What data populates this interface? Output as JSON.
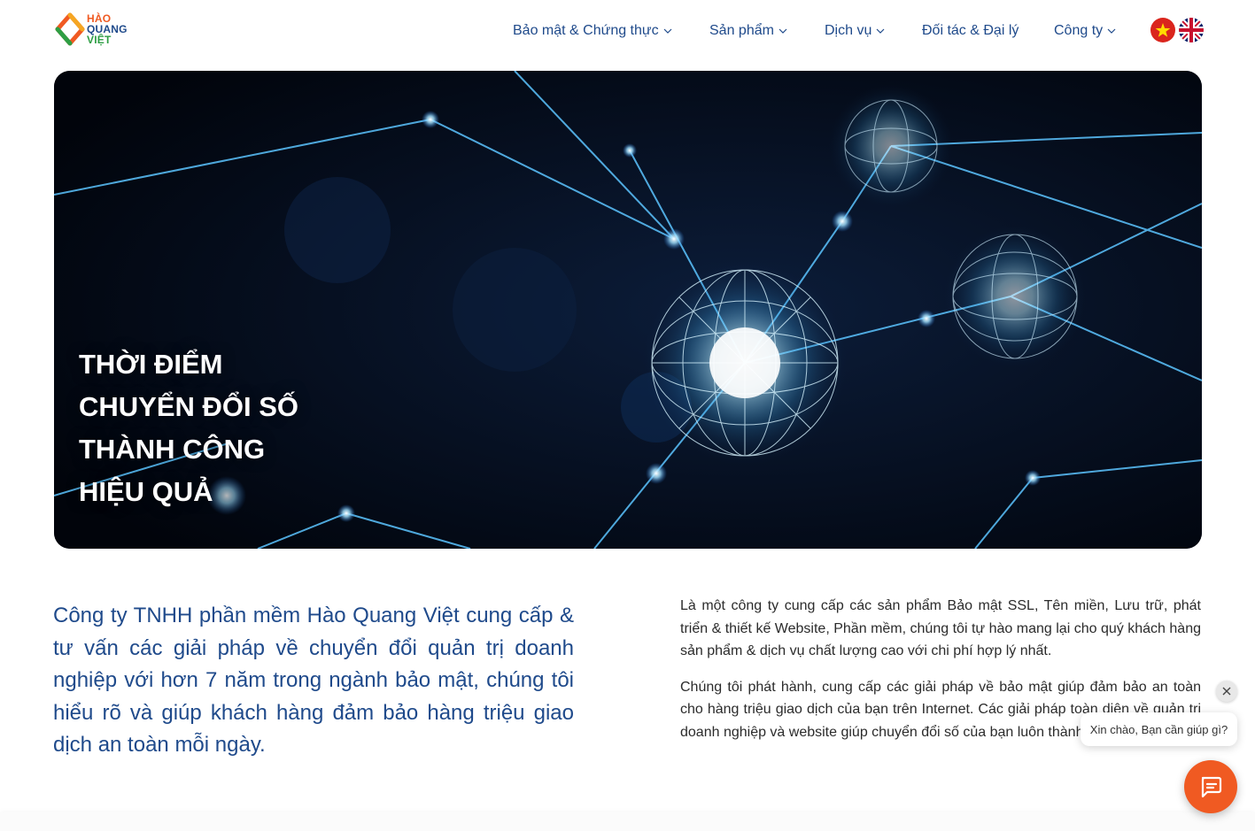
{
  "brand": {
    "logo_text_1": "HÀO",
    "logo_text_2": "QUANG",
    "logo_text_3": "VIỆT",
    "colors": {
      "primary": "#1f4a8b",
      "accent": "#f05a22",
      "green": "#2e9e44"
    }
  },
  "nav": {
    "items": [
      {
        "label": "Bảo mật & Chứng thực",
        "has_dropdown": true
      },
      {
        "label": "Sản phẩm",
        "has_dropdown": true
      },
      {
        "label": "Dịch vụ",
        "has_dropdown": true
      },
      {
        "label": "Đối tác & Đại lý",
        "has_dropdown": false
      },
      {
        "label": "Công ty",
        "has_dropdown": true
      }
    ],
    "languages": [
      {
        "icon": "vietnam-flag-icon",
        "code": "vi"
      },
      {
        "icon": "uk-flag-icon",
        "code": "en"
      }
    ]
  },
  "hero": {
    "title_lines": [
      "THỜI ĐIỂM",
      "CHUYỂN ĐỔI SỐ",
      "THÀNH CÔNG",
      "HIỆU QUẢ"
    ]
  },
  "intro": {
    "left_text": "Công ty TNHH phần mềm Hào Quang Việt cung cấp & tư vấn các giải pháp về chuyển đổi quản trị doanh nghiệp với hơn 7 năm trong ngành bảo mật, chúng tôi hiểu rõ và giúp khách hàng đảm bảo hàng triệu giao dịch an toàn mỗi ngày.",
    "right_paragraphs": [
      "Là một công ty cung cấp các sản phẩm Bảo mật SSL, Tên miền, Lưu trữ, phát triển & thiết kế Website, Phần mềm, chúng tôi tự hào mang lại cho quý khách hàng sản phẩm & dịch vụ chất lượng cao với chi phí hợp lý nhất.",
      "Chúng tôi phát hành, cung cấp các giải pháp về bảo mật giúp đảm bảo an toàn cho hàng triệu giao dịch của bạn trên Internet. Các giải pháp toàn diện về quản trị doanh nghiệp và website giúp chuyển đổi số của bạn luôn thành công."
    ]
  },
  "chat": {
    "greeting": "Xin chào, Bạn cần giúp gì?",
    "close_icon": "close-icon",
    "button_icon": "chat-icon"
  }
}
